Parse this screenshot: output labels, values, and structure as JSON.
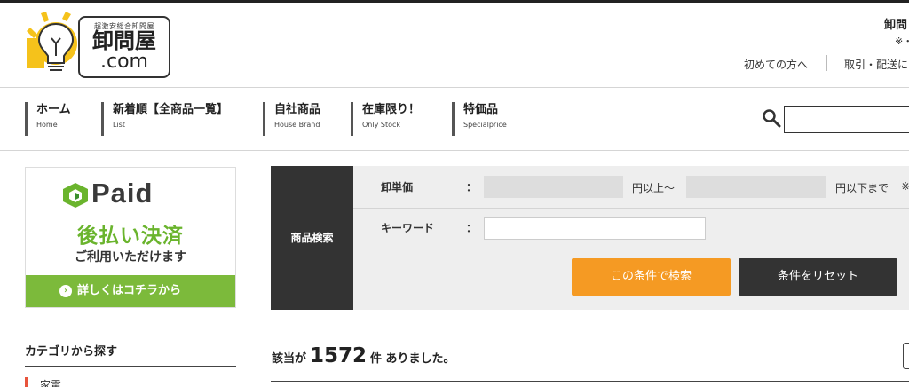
{
  "site": {
    "tagline": "超激安総合卸問屋",
    "name": "卸問屋",
    "domain": ".com"
  },
  "header": {
    "right_title": "卸問",
    "right_sub": "※・",
    "link_first_time": "初めての方へ",
    "link_shipping": "取引・配送に"
  },
  "nav": [
    {
      "label": "ホーム",
      "sub": "Home"
    },
    {
      "label": "新着順【全商品一覧】",
      "sub": "List"
    },
    {
      "label": "自社商品",
      "sub": "House Brand"
    },
    {
      "label": "在庫限り！",
      "sub": "Only Stock"
    },
    {
      "label": "特価品",
      "sub": "Specialprice"
    }
  ],
  "search": {
    "placeholder": ""
  },
  "paid_banner": {
    "brand": "Paid",
    "headline": "後払い決済",
    "subtext": "ご利用いただけます",
    "cta": "詳しくはコチラから",
    "cta_arrow": "›",
    "brand_color": "#6ab42d"
  },
  "sidebar": {
    "category_title": "カテゴリから探す",
    "first_category": "家電"
  },
  "search_panel": {
    "title": "商品検索",
    "price_label": "卸単価",
    "colon": "：",
    "price_min_unit": "円以上～",
    "price_max_unit": "円以下まで",
    "price_note": "※",
    "keyword_label": "キーワード",
    "price_min_value": "",
    "price_max_value": "",
    "keyword_value": "",
    "search_button": "この条件で検索",
    "reset_button": "条件をリセット",
    "accent_color": "#f59a23"
  },
  "results": {
    "prefix": "該当が",
    "count": "1572",
    "suffix": "件 ありました。"
  }
}
